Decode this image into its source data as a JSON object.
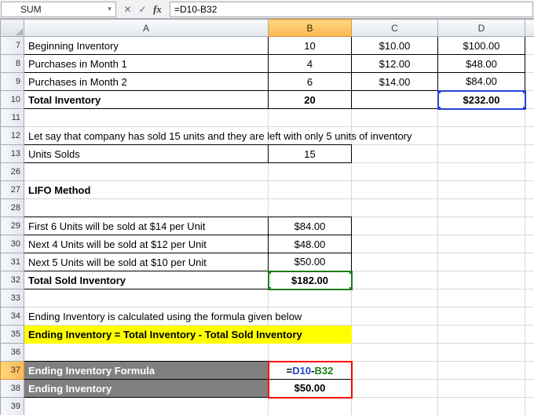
{
  "formula_bar": {
    "name_box_value": "SUM",
    "dropdown_icon": "▾",
    "cancel_icon": "✕",
    "enter_icon": "✓",
    "insert_function_icon": "fx",
    "formula": "=D10-B32"
  },
  "colors": {
    "ref_blue": "#2442D6",
    "ref_green": "#1C7C1C",
    "annotation_red": "#FF0000",
    "label_gray_bg": "#808080",
    "highlight_yellow": "#FFFF00",
    "active_header_orange": "#FBB754"
  },
  "sheet": {
    "column_headers": [
      "A",
      "B",
      "C",
      "D"
    ],
    "active_column": "B",
    "active_row": "37",
    "rows": [
      {
        "n": "7",
        "cells": {
          "A": {
            "t": "Beginning Inventory",
            "box": 1
          },
          "B": {
            "t": "10",
            "box": 1
          },
          "C": {
            "t": "$10.00",
            "box": 1
          },
          "D": {
            "t": "$100.00",
            "box": 1
          }
        }
      },
      {
        "n": "8",
        "cells": {
          "A": {
            "t": "Purchases in Month 1",
            "box": 1
          },
          "B": {
            "t": "4",
            "box": 1
          },
          "C": {
            "t": "$12.00",
            "box": 1
          },
          "D": {
            "t": "$48.00",
            "box": 1
          }
        }
      },
      {
        "n": "9",
        "cells": {
          "A": {
            "t": "Purchases in Month 2",
            "box": 1
          },
          "B": {
            "t": "6",
            "box": 1
          },
          "C": {
            "t": "$14.00",
            "box": 1
          },
          "D": {
            "t": "$84.00",
            "box": 1
          }
        }
      },
      {
        "n": "10",
        "cells": {
          "A": {
            "t": "Total Inventory",
            "box": 1,
            "b": 1
          },
          "B": {
            "t": "20",
            "box": 1,
            "b": 1
          },
          "C": {
            "t": "",
            "box": 1
          },
          "D": {
            "t": "$232.00",
            "box": 1,
            "b": 1,
            "ref": "blue"
          }
        }
      },
      {
        "n": "11",
        "cells": {}
      },
      {
        "n": "12",
        "cells": {
          "A": {
            "t": "Let say that company has sold 15 units and they are left with only 5 units of inventory",
            "spill": 1,
            "bb": 1
          },
          "B": {
            "bb": 1
          }
        }
      },
      {
        "n": "13",
        "cells": {
          "A": {
            "t": "Units Solds",
            "box": 1
          },
          "B": {
            "t": "15",
            "box": 1
          }
        }
      },
      {
        "n": "26",
        "cells": {}
      },
      {
        "n": "27",
        "cells": {
          "A": {
            "t": "LIFO Method",
            "b": 1
          }
        }
      },
      {
        "n": "28",
        "cells": {
          "A": {
            "bb": 1
          },
          "B": {
            "bb": 1
          }
        }
      },
      {
        "n": "29",
        "cells": {
          "A": {
            "t": "First 6 Units will be sold at $14 per Unit",
            "box": 1
          },
          "B": {
            "t": "$84.00",
            "box": 1
          }
        }
      },
      {
        "n": "30",
        "cells": {
          "A": {
            "t": "Next 4 Units will be sold at $12 per Unit",
            "box": 1
          },
          "B": {
            "t": "$48.00",
            "box": 1
          }
        }
      },
      {
        "n": "31",
        "cells": {
          "A": {
            "t": "Next 5 Units will be sold at $10 per Unit",
            "box": 1
          },
          "B": {
            "t": "$50.00",
            "box": 1
          }
        }
      },
      {
        "n": "32",
        "cells": {
          "A": {
            "t": "Total Sold Inventory",
            "box": 1,
            "b": 1
          },
          "B": {
            "t": "$182.00",
            "box": 1,
            "b": 1,
            "ref": "green"
          }
        }
      },
      {
        "n": "33",
        "cells": {}
      },
      {
        "n": "34",
        "cells": {
          "A": {
            "t": "Ending Inventory is calculated using the formula given below",
            "spill": 1
          }
        }
      },
      {
        "n": "35",
        "cells": {
          "A": {
            "t": "Ending Inventory = Total Inventory - Total Sold Inventory",
            "b": 1,
            "fill": "yellow",
            "spill": 1
          },
          "B": {
            "fill": "yellow"
          }
        }
      },
      {
        "n": "36",
        "cells": {
          "A": {
            "bb": 1
          },
          "B": {
            "bb": 1
          }
        }
      },
      {
        "n": "37",
        "cells": {
          "A": {
            "t": "Ending Inventory Formula",
            "fill": "gray",
            "box": 1
          },
          "B": {
            "seg": [
              {
                "t": "=",
                "c": "black"
              },
              {
                "t": "D10",
                "c": "blue"
              },
              {
                "t": "-",
                "c": "black"
              },
              {
                "t": "B32",
                "c": "green"
              }
            ],
            "b": 1,
            "box": 1,
            "red": "top"
          }
        }
      },
      {
        "n": "38",
        "cells": {
          "A": {
            "t": "Ending Inventory",
            "fill": "gray",
            "box": 1
          },
          "B": {
            "t": "$50.00",
            "box": 1,
            "b": 1,
            "red": "bottom"
          }
        }
      },
      {
        "n": "39",
        "cells": {}
      }
    ]
  }
}
